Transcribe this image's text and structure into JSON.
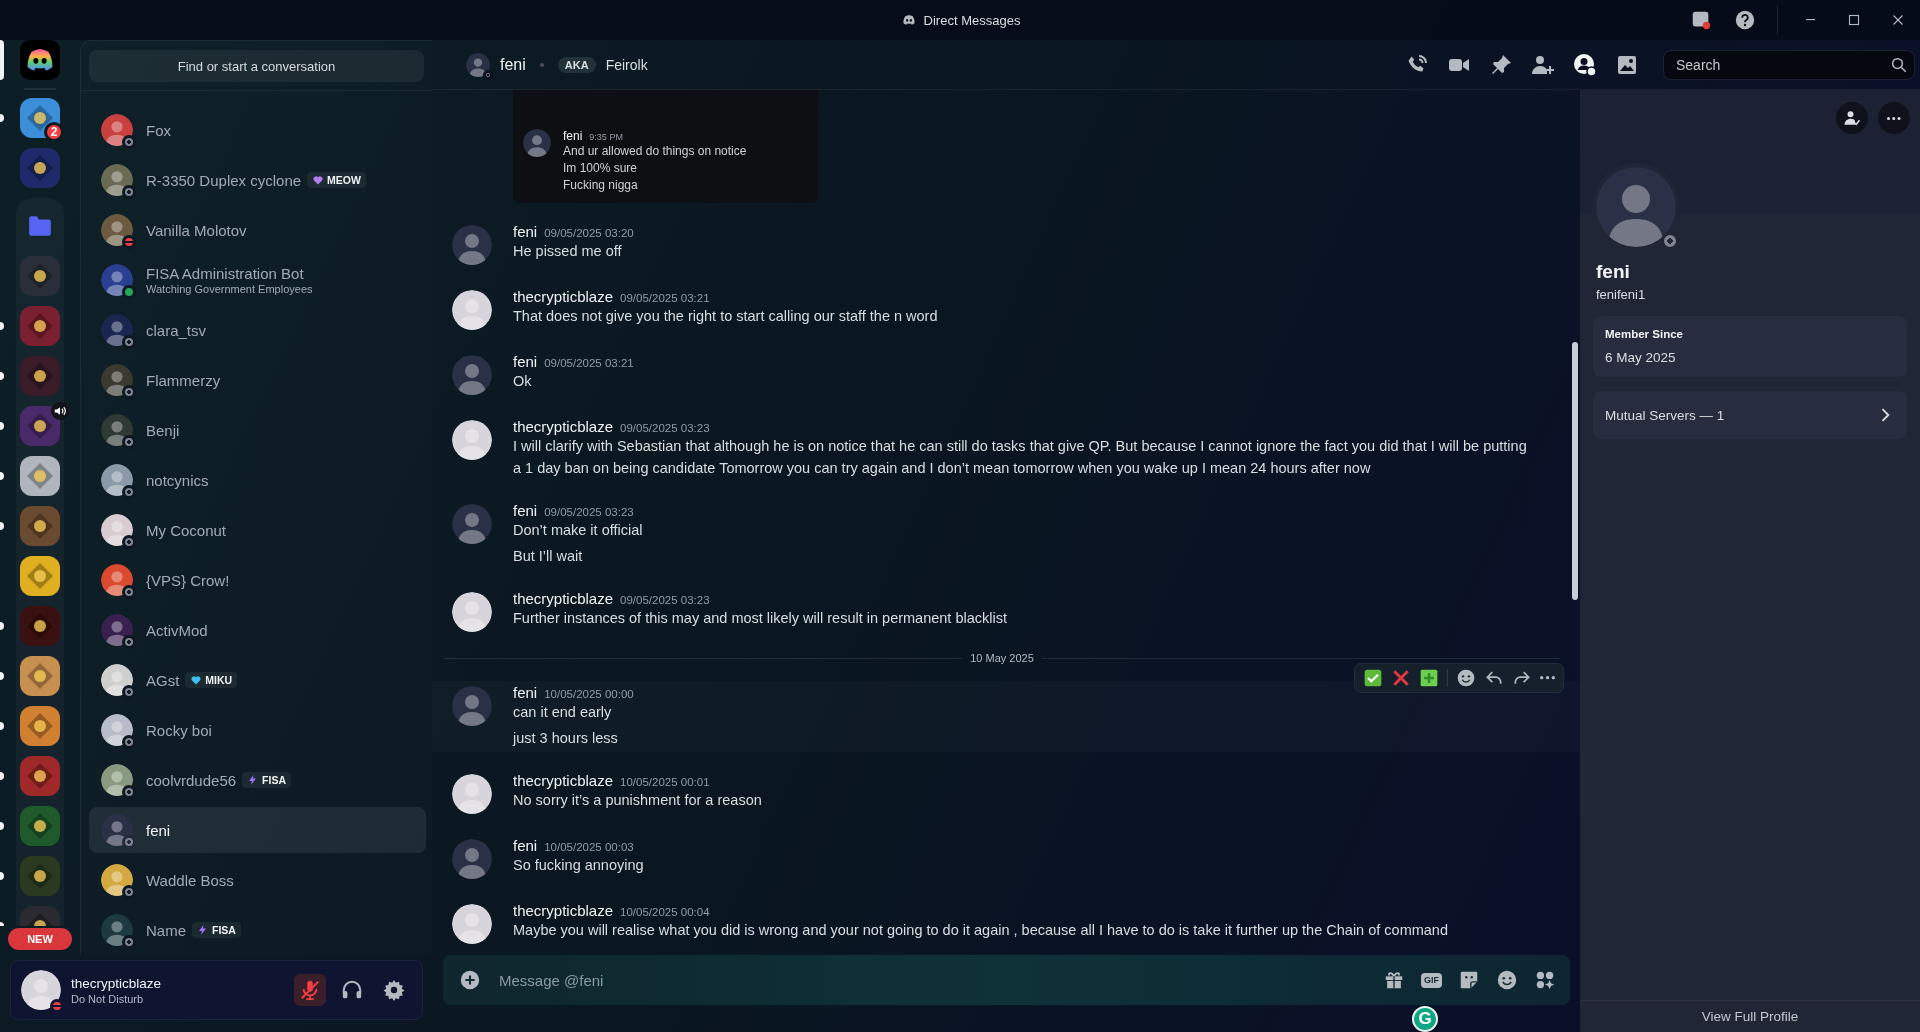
{
  "window": {
    "title": "Direct Messages"
  },
  "rail": {
    "home": {
      "selected": true
    },
    "servers": [
      {
        "color": "#3a8fd8",
        "unread": true,
        "badge": "2"
      },
      {
        "color": "#1f2a6b",
        "unread": false
      }
    ],
    "folder": {
      "expanded": true,
      "color": "#5865f2",
      "servers": [
        {
          "color": "#2b2f3a",
          "unread": false
        },
        {
          "color": "#7a2030",
          "unread": true
        },
        {
          "color": "#3a1c28",
          "unread": true
        },
        {
          "color": "#4a2a6a",
          "unread": true,
          "audio": true
        },
        {
          "color": "#b0b4bc",
          "unread": true
        },
        {
          "color": "#6a4a30",
          "unread": true
        },
        {
          "color": "#e0b020",
          "unread": false
        },
        {
          "color": "#3a1010",
          "unread": true
        },
        {
          "color": "#c89050",
          "unread": true
        },
        {
          "color": "#d08030",
          "unread": true
        },
        {
          "color": "#a02828",
          "unread": true
        },
        {
          "color": "#1e5a2a",
          "unread": true
        },
        {
          "color": "#2a3a20",
          "unread": true
        },
        {
          "color": "#2a2a30",
          "unread": true
        }
      ]
    },
    "new_pill": "NEW"
  },
  "dm_search": {
    "label": "Find or start a conversation"
  },
  "dms": [
    {
      "name": "Fox",
      "kind": "offline",
      "selected": false
    },
    {
      "name": "R-3350 Duplex cyclone",
      "kind": "offline",
      "selected": false,
      "tag": {
        "label": "MEOW",
        "kind": "heart",
        "color": "#b57cf5"
      }
    },
    {
      "name": "Vanilla Molotov",
      "kind": "dnd",
      "selected": false
    },
    {
      "name": "FISA Administration Bot",
      "kind": "online",
      "selected": false,
      "activity": "Watching Government Employees"
    },
    {
      "name": "clara_tsv",
      "kind": "offline",
      "selected": false
    },
    {
      "name": "Flammerzy",
      "kind": "offline",
      "selected": false
    },
    {
      "name": "Benji",
      "kind": "offline",
      "selected": false
    },
    {
      "name": "notcynics",
      "kind": "offline",
      "selected": false
    },
    {
      "name": "My Coconut",
      "kind": "offline",
      "selected": false
    },
    {
      "name": "{VPS} Crow!",
      "kind": "offline",
      "selected": false
    },
    {
      "name": "ActivMod",
      "kind": "offline",
      "selected": false
    },
    {
      "name": "AGst",
      "kind": "offline",
      "selected": false,
      "tag": {
        "label": "MIKU",
        "kind": "heart",
        "color": "#3fc0f0"
      }
    },
    {
      "name": "Rocky boi",
      "kind": "offline",
      "selected": false
    },
    {
      "name": "coolvrdude56",
      "kind": "offline",
      "selected": false,
      "tag": {
        "label": "FISA",
        "kind": "bolt",
        "color": "#a070ff"
      }
    },
    {
      "name": "feni",
      "kind": "offline",
      "selected": true
    },
    {
      "name": "Waddle Boss",
      "kind": "offline",
      "selected": false
    },
    {
      "name": "Name",
      "kind": "offline",
      "selected": false,
      "tag": {
        "label": "FISA",
        "kind": "bolt",
        "color": "#a070ff"
      }
    }
  ],
  "user": {
    "name": "thecrypticblaze",
    "status_text": "Do Not Disturb",
    "kind": "dnd",
    "muted": true
  },
  "chat_header": {
    "name": "feni",
    "kind": "offline",
    "aka": "AKA",
    "nickname": "Feirolk",
    "search_placeholder": "Search"
  },
  "messages": [
    {
      "kind": "image",
      "author": "feni",
      "time": "9:35 PM",
      "lines": [
        "And ur allowed do things on notice",
        "Im 100% sure",
        "Fucking nigga"
      ]
    },
    {
      "kind": "group",
      "author": "feni",
      "from_me": false,
      "timestamp": "09/05/2025 03:20",
      "lines": [
        "He pissed me off"
      ],
      "hovered": false
    },
    {
      "kind": "group",
      "author": "thecrypticblaze",
      "from_me": true,
      "timestamp": "09/05/2025 03:21",
      "lines": [
        "That does not give you the right to start calling our staff the n word"
      ],
      "hovered": false
    },
    {
      "kind": "group",
      "author": "feni",
      "from_me": false,
      "timestamp": "09/05/2025 03:21",
      "lines": [
        "Ok"
      ],
      "hovered": false
    },
    {
      "kind": "group",
      "author": "thecrypticblaze",
      "from_me": true,
      "timestamp": "09/05/2025 03:23",
      "lines": [
        "I will clarify with Sebastian that although he is on notice that he can still do tasks that give QP. But because I cannot ignore the fact you did that I will be putting a 1 day ban on being candidate Tomorrow you can try again and I don’t mean tomorrow when you wake up I mean 24 hours after now"
      ],
      "hovered": false
    },
    {
      "kind": "group",
      "author": "feni",
      "from_me": false,
      "timestamp": "09/05/2025 03:23",
      "lines": [
        "Don’t make it official",
        "But I’ll wait"
      ],
      "hovered": false
    },
    {
      "kind": "group",
      "author": "thecrypticblaze",
      "from_me": true,
      "timestamp": "09/05/2025 03:23",
      "lines": [
        "Further instances of this may and most likely will result in permanent blacklist"
      ],
      "hovered": false
    },
    {
      "kind": "divider",
      "label": "10 May 2025"
    },
    {
      "kind": "group",
      "author": "feni",
      "from_me": false,
      "timestamp": "10/05/2025 00:00",
      "lines": [
        "can it end early",
        "just 3 hours less"
      ],
      "hovered": true
    },
    {
      "kind": "group",
      "author": "thecrypticblaze",
      "from_me": true,
      "timestamp": "10/05/2025 00:01",
      "lines": [
        "No sorry it’s a punishment for a reason"
      ],
      "hovered": false
    },
    {
      "kind": "group",
      "author": "feni",
      "from_me": false,
      "timestamp": "10/05/2025 00:03",
      "lines": [
        "So fucking annoying"
      ],
      "hovered": false
    },
    {
      "kind": "group",
      "author": "thecrypticblaze",
      "from_me": true,
      "timestamp": "10/05/2025 00:04",
      "lines": [
        "Maybe you will realise what you did is wrong and your not going to do it again , because all I have to do is take it further up the Chain of command"
      ],
      "hovered": false
    }
  ],
  "composer": {
    "placeholder": "Message @feni",
    "gif_label": "GIF",
    "assistant_badge": "G"
  },
  "profile": {
    "name": "feni",
    "username": "fenifeni1",
    "kind": "offline",
    "member_since_label": "Member Since",
    "member_since": "6 May 2025",
    "mutual_servers": "Mutual Servers — 1",
    "view_full": "View Full Profile"
  }
}
